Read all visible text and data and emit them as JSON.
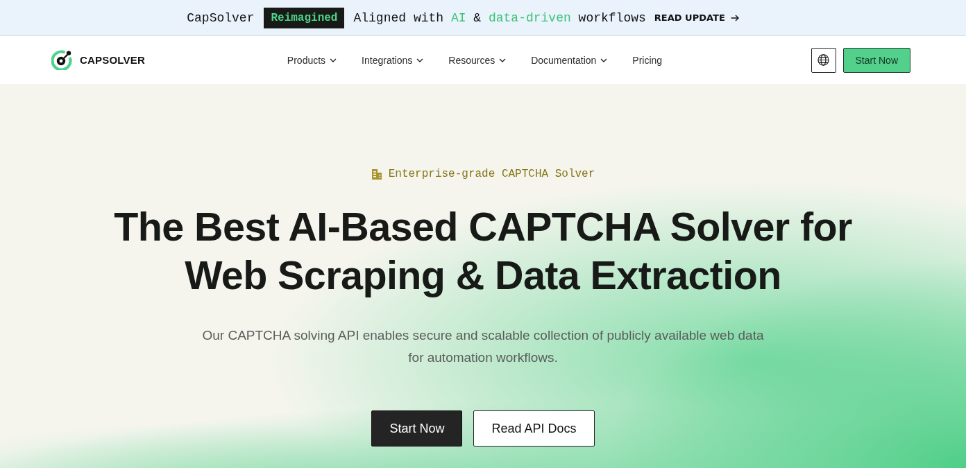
{
  "banner": {
    "brand": "CapSolver",
    "badge": "Reimagined",
    "message": [
      {
        "text": "Aligned with",
        "accent": false
      },
      {
        "text": "AI",
        "accent": true
      },
      {
        "text": "&",
        "accent": false
      },
      {
        "text": "data-driven",
        "accent": true
      },
      {
        "text": "workflows",
        "accent": false
      }
    ],
    "link": "READ UPDATE"
  },
  "navbar": {
    "logo": "CAPSOLVER",
    "items": [
      {
        "label": "Products",
        "dropdown": true
      },
      {
        "label": "Integrations",
        "dropdown": true
      },
      {
        "label": "Resources",
        "dropdown": true
      },
      {
        "label": "Documentation",
        "dropdown": true
      },
      {
        "label": "Pricing",
        "dropdown": false
      }
    ],
    "cta": "Start Now"
  },
  "hero": {
    "eyebrow": "Enterprise-grade CAPTCHA Solver",
    "title": "The Best AI-Based CAPTCHA Solver for Web Scraping & Data Extraction",
    "subtitle": "Our CAPTCHA solving API enables secure and scalable collection of publicly available web data for automation workflows.",
    "buttons": [
      {
        "label": "Start Now",
        "kind": "primary"
      },
      {
        "label": "Read API Docs",
        "kind": "secondary"
      }
    ]
  }
}
